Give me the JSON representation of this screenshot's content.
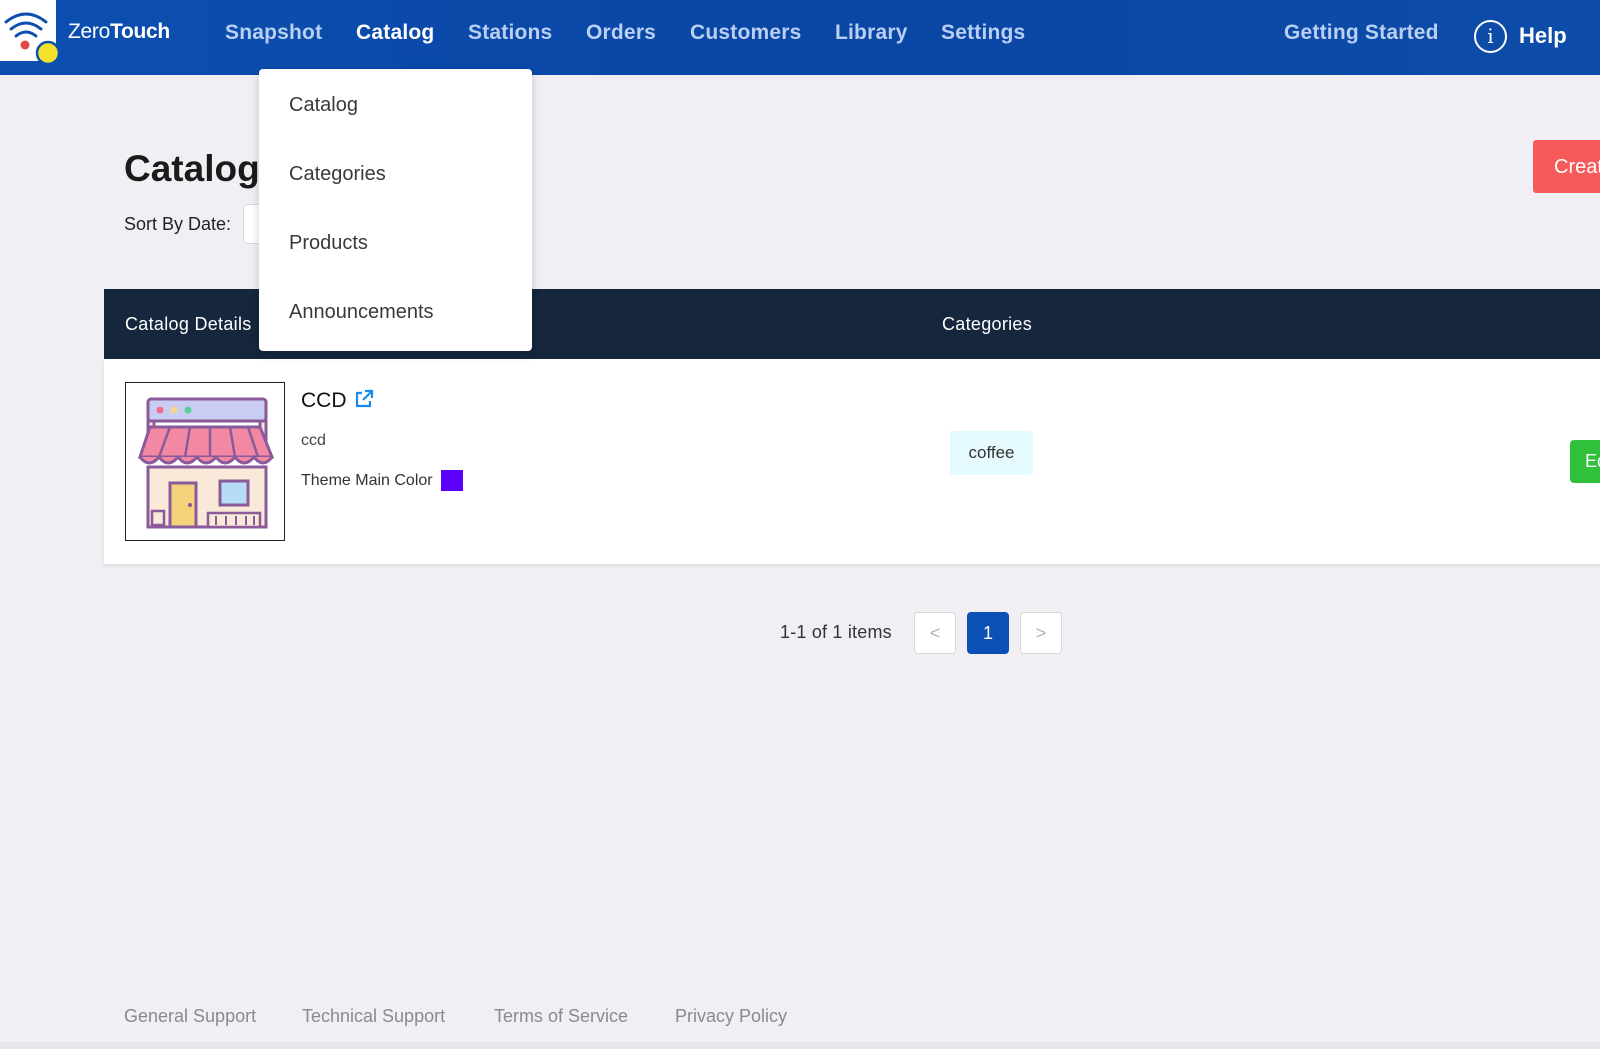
{
  "app": {
    "brand_light": "Zero",
    "brand_bold": "Touch"
  },
  "nav": {
    "items": [
      {
        "label": "Snapshot",
        "active": false
      },
      {
        "label": "Catalog",
        "active": true
      },
      {
        "label": "Stations",
        "active": false
      },
      {
        "label": "Orders",
        "active": false
      },
      {
        "label": "Customers",
        "active": false
      },
      {
        "label": "Library",
        "active": false
      },
      {
        "label": "Settings",
        "active": false
      }
    ],
    "getting_started": "Getting Started",
    "help": "Help"
  },
  "dropdown": {
    "items": [
      "Catalog",
      "Categories",
      "Products",
      "Announcements"
    ]
  },
  "page": {
    "title": "Catalog",
    "sort_label": "Sort By Date:",
    "create_label": "Create"
  },
  "table": {
    "headers": [
      "Catalog Details",
      "Categories"
    ],
    "rows": [
      {
        "name": "CCD",
        "slug": "ccd",
        "theme_label": "Theme Main Color",
        "theme_color": "#5b00ff",
        "category_tag": "coffee",
        "action_label": "Edit"
      }
    ]
  },
  "pagination": {
    "total_text": "1-1 of 1 items",
    "prev": "<",
    "current": "1",
    "next": ">"
  },
  "footer": {
    "links": [
      "General Support",
      "Technical Support",
      "Terms of Service",
      "Privacy Policy"
    ]
  },
  "colors": {
    "nav_bg": "#0c4fb0",
    "table_header_bg": "#15263d",
    "create_button": "#f65a5a",
    "edit_button": "#2fc13b",
    "pagination_active": "#0c4fb5",
    "tag_bg": "#e6fbff"
  }
}
